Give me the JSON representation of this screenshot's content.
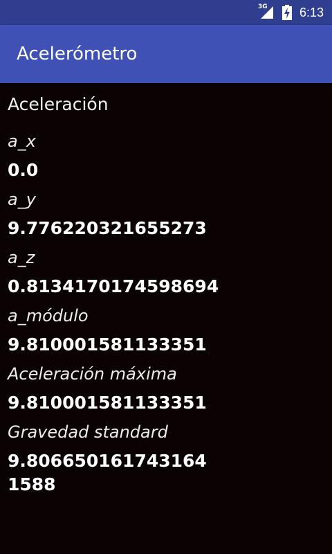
{
  "status_bar": {
    "network_type": "3G",
    "signal_icon": "cellular-signal-icon",
    "battery_icon": "battery-charging-icon",
    "time": "6:13"
  },
  "app_bar": {
    "title": "Acelerómetro",
    "color": "#3f51b5"
  },
  "main": {
    "heading": "Aceleración",
    "fields": [
      {
        "label": "a_x",
        "value": "0.0"
      },
      {
        "label": "a_y",
        "value": "9.776220321655273"
      },
      {
        "label": "a_z",
        "value": "0.8134170174598694"
      },
      {
        "label": "a_módulo",
        "value": "9.810001581133351"
      },
      {
        "label": "Aceleración máxima",
        "value": "9.810001581133351"
      },
      {
        "label": "Gravedad standard",
        "value": "9.806650161743164",
        "value_line2": "1588"
      }
    ]
  }
}
